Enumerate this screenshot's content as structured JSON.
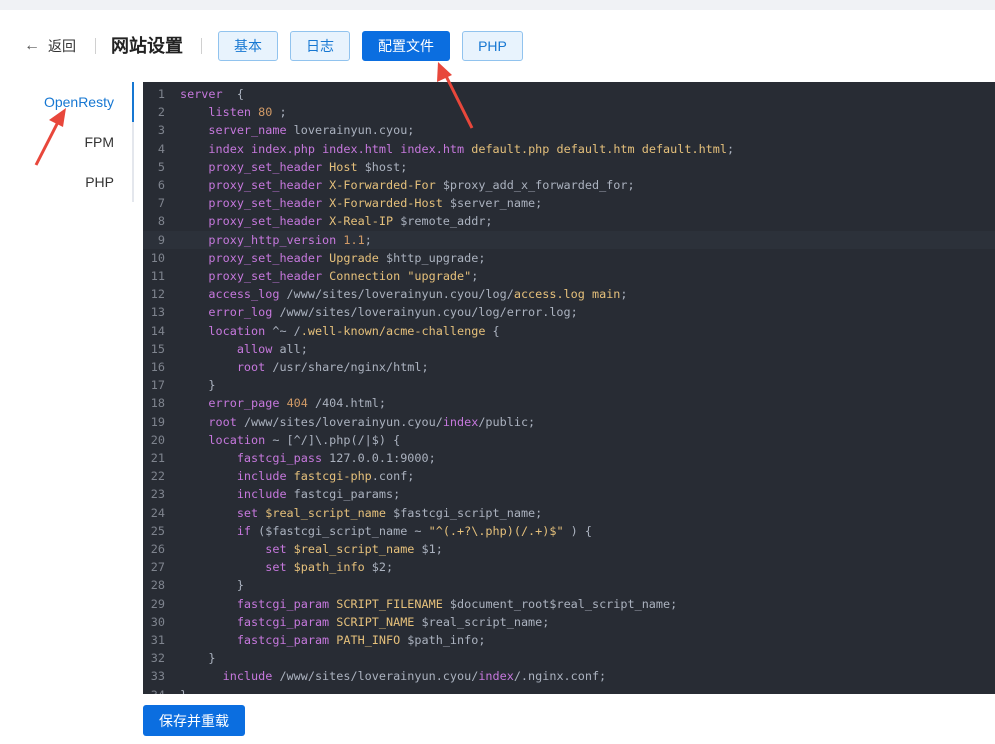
{
  "header": {
    "back_label": "返回",
    "title": "网站设置",
    "tabs": [
      {
        "label": "基本",
        "active": false
      },
      {
        "label": "日志",
        "active": false
      },
      {
        "label": "配置文件",
        "active": true
      },
      {
        "label": "PHP",
        "active": false
      }
    ]
  },
  "sidebar": {
    "items": [
      {
        "label": "OpenResty",
        "active": true
      },
      {
        "label": "FPM",
        "active": false
      },
      {
        "label": "PHP",
        "active": false
      }
    ]
  },
  "editor": {
    "theme": "dark",
    "current_line": 9,
    "lines": [
      {
        "n": "1",
        "segs": [
          [
            "kw",
            "server"
          ],
          [
            "",
            "  {"
          ]
        ]
      },
      {
        "n": "2",
        "segs": [
          [
            "",
            "    "
          ],
          [
            "kw",
            "listen"
          ],
          [
            "",
            "",
            " "
          ],
          [
            "nm",
            "80"
          ],
          [
            "",
            "",
            " ;"
          ]
        ]
      },
      {
        "n": "3",
        "segs": [
          [
            "",
            "    "
          ],
          [
            "kw",
            "server_name"
          ],
          [
            "",
            "",
            " loverainyun.cyou;"
          ]
        ]
      },
      {
        "n": "4",
        "segs": [
          [
            "",
            "    "
          ],
          [
            "kw",
            "index"
          ],
          [
            "",
            "",
            " "
          ],
          [
            "kw",
            "index.php"
          ],
          [
            "",
            "",
            " "
          ],
          [
            "kw",
            "index.html"
          ],
          [
            "",
            "",
            " "
          ],
          [
            "kw",
            "index.htm"
          ],
          [
            "",
            "",
            " "
          ],
          [
            "st",
            "default.php"
          ],
          [
            "",
            "",
            " "
          ],
          [
            "st",
            "default.htm"
          ],
          [
            "",
            "",
            " "
          ],
          [
            "st",
            "default.html"
          ],
          [
            "",
            ";"
          ]
        ]
      },
      {
        "n": "5",
        "segs": [
          [
            "",
            "    "
          ],
          [
            "kw",
            "proxy_set_header"
          ],
          [
            "",
            "",
            " "
          ],
          [
            "st",
            "Host"
          ],
          [
            "",
            "",
            " $host;"
          ]
        ]
      },
      {
        "n": "6",
        "segs": [
          [
            "",
            "    "
          ],
          [
            "kw",
            "proxy_set_header"
          ],
          [
            "",
            "",
            " "
          ],
          [
            "st",
            "X-Forwarded-For"
          ],
          [
            "",
            "",
            " $proxy_add_x_forwarded_for;"
          ]
        ]
      },
      {
        "n": "7",
        "segs": [
          [
            "",
            "    "
          ],
          [
            "kw",
            "proxy_set_header"
          ],
          [
            "",
            "",
            " "
          ],
          [
            "st",
            "X-Forwarded-Host"
          ],
          [
            "",
            "",
            " $server_name;"
          ]
        ]
      },
      {
        "n": "8",
        "segs": [
          [
            "",
            "    "
          ],
          [
            "kw",
            "proxy_set_header"
          ],
          [
            "",
            "",
            " "
          ],
          [
            "st",
            "X-Real-IP"
          ],
          [
            "",
            "",
            " $remote_addr;"
          ]
        ]
      },
      {
        "n": "9",
        "segs": [
          [
            "",
            "    "
          ],
          [
            "kw",
            "proxy_http_version"
          ],
          [
            "",
            "",
            " "
          ],
          [
            "nm",
            "1.1"
          ],
          [
            "",
            ";"
          ]
        ]
      },
      {
        "n": "10",
        "segs": [
          [
            "",
            "    "
          ],
          [
            "kw",
            "proxy_set_header"
          ],
          [
            "",
            "",
            " "
          ],
          [
            "st",
            "Upgrade"
          ],
          [
            "",
            "",
            " $http_upgrade;"
          ]
        ]
      },
      {
        "n": "11",
        "segs": [
          [
            "",
            "    "
          ],
          [
            "kw",
            "proxy_set_header"
          ],
          [
            "",
            "",
            " "
          ],
          [
            "st",
            "Connection"
          ],
          [
            "",
            "",
            " "
          ],
          [
            "st",
            "\"upgrade\""
          ],
          [
            "",
            ";"
          ]
        ]
      },
      {
        "n": "12",
        "segs": [
          [
            "",
            "    "
          ],
          [
            "kw",
            "access_log"
          ],
          [
            "",
            "",
            " /www/sites/loverainyun.cyou/log/"
          ],
          [
            "st",
            "access.log"
          ],
          [
            "",
            "",
            " "
          ],
          [
            "st",
            "main"
          ],
          [
            "",
            ";"
          ]
        ]
      },
      {
        "n": "13",
        "segs": [
          [
            "",
            "    "
          ],
          [
            "kw",
            "error_log"
          ],
          [
            "",
            "",
            " /www/sites/loverainyun.cyou/log/error.log;"
          ]
        ]
      },
      {
        "n": "14",
        "segs": [
          [
            "",
            "    "
          ],
          [
            "kw",
            "location"
          ],
          [
            "",
            "",
            " ^~ /"
          ],
          [
            "st",
            ".well-known/acme-challenge"
          ],
          [
            "",
            "",
            " {"
          ]
        ]
      },
      {
        "n": "15",
        "segs": [
          [
            "",
            "        "
          ],
          [
            "kw",
            "allow"
          ],
          [
            "",
            "",
            " all;"
          ]
        ]
      },
      {
        "n": "16",
        "segs": [
          [
            "",
            "        "
          ],
          [
            "kw",
            "root"
          ],
          [
            "",
            "",
            " /usr/share/nginx/html;"
          ]
        ]
      },
      {
        "n": "17",
        "segs": [
          [
            "",
            "    }"
          ]
        ]
      },
      {
        "n": "18",
        "segs": [
          [
            "",
            "    "
          ],
          [
            "kw",
            "error_page"
          ],
          [
            "",
            "",
            " "
          ],
          [
            "nm",
            "404"
          ],
          [
            "",
            "",
            " /404.html;"
          ]
        ]
      },
      {
        "n": "19",
        "segs": [
          [
            "",
            "    "
          ],
          [
            "kw",
            "root"
          ],
          [
            "",
            "",
            " /www/sites/loverainyun.cyou/"
          ],
          [
            "kw",
            "index"
          ],
          [
            "",
            "/public;"
          ]
        ]
      },
      {
        "n": "20",
        "segs": [
          [
            "",
            "    "
          ],
          [
            "kw",
            "location"
          ],
          [
            "",
            "",
            " ~ [^/]\\.php(/|$) {"
          ]
        ]
      },
      {
        "n": "21",
        "segs": [
          [
            "",
            "        "
          ],
          [
            "kw",
            "fastcgi_pass"
          ],
          [
            "",
            "",
            " 127.0.0.1:9000;"
          ]
        ]
      },
      {
        "n": "22",
        "segs": [
          [
            "",
            "        "
          ],
          [
            "kw",
            "include"
          ],
          [
            "",
            "",
            " "
          ],
          [
            "st",
            "fastcgi-php"
          ],
          [
            "",
            ".conf;"
          ]
        ]
      },
      {
        "n": "23",
        "segs": [
          [
            "",
            "        "
          ],
          [
            "kw",
            "include"
          ],
          [
            "",
            "",
            " fastcgi_params;"
          ]
        ]
      },
      {
        "n": "24",
        "segs": [
          [
            "",
            "        "
          ],
          [
            "kw",
            "set"
          ],
          [
            "",
            "",
            " "
          ],
          [
            "st",
            "$real_script_name"
          ],
          [
            "",
            "",
            " $fastcgi_script_name;"
          ]
        ]
      },
      {
        "n": "25",
        "segs": [
          [
            "",
            "        "
          ],
          [
            "kw",
            "if"
          ],
          [
            "",
            "",
            " ($fastcgi_script_name ~ "
          ],
          [
            "st",
            "\"^(.+?\\.php)(/.+)$\""
          ],
          [
            "",
            "",
            " ) {"
          ]
        ]
      },
      {
        "n": "26",
        "segs": [
          [
            "",
            "            "
          ],
          [
            "kw",
            "set"
          ],
          [
            "",
            "",
            " "
          ],
          [
            "st",
            "$real_script_name"
          ],
          [
            "",
            "",
            " $1;"
          ]
        ]
      },
      {
        "n": "27",
        "segs": [
          [
            "",
            "            "
          ],
          [
            "kw",
            "set"
          ],
          [
            "",
            "",
            " "
          ],
          [
            "st",
            "$path_info"
          ],
          [
            "",
            "",
            " $2;"
          ]
        ]
      },
      {
        "n": "28",
        "segs": [
          [
            "",
            "        }"
          ]
        ]
      },
      {
        "n": "29",
        "segs": [
          [
            "",
            "        "
          ],
          [
            "kw",
            "fastcgi_param"
          ],
          [
            "",
            "",
            " "
          ],
          [
            "st",
            "SCRIPT_FILENAME"
          ],
          [
            "",
            "",
            " $document_root$real_script_name;"
          ]
        ]
      },
      {
        "n": "30",
        "segs": [
          [
            "",
            "        "
          ],
          [
            "kw",
            "fastcgi_param"
          ],
          [
            "",
            "",
            " "
          ],
          [
            "st",
            "SCRIPT_NAME"
          ],
          [
            "",
            "",
            " $real_script_name;"
          ]
        ]
      },
      {
        "n": "31",
        "segs": [
          [
            "",
            "        "
          ],
          [
            "kw",
            "fastcgi_param"
          ],
          [
            "",
            "",
            " "
          ],
          [
            "st",
            "PATH_INFO"
          ],
          [
            "",
            "",
            " $path_info;"
          ]
        ]
      },
      {
        "n": "32",
        "segs": [
          [
            "",
            "    }"
          ]
        ]
      },
      {
        "n": "33",
        "segs": [
          [
            "",
            "      "
          ],
          [
            "kw",
            "include"
          ],
          [
            "",
            "",
            " /www/sites/loverainyun.cyou/"
          ],
          [
            "kw",
            "index"
          ],
          [
            "",
            "/.nginx.conf;"
          ]
        ]
      },
      {
        "n": "34",
        "segs": [
          [
            "",
            "}"
          ]
        ]
      }
    ]
  },
  "footer": {
    "save_label": "保存并重载"
  },
  "colors": {
    "accent": "#0b6ee0",
    "annotation_arrow": "#e8473b",
    "editor_bg": "#282c34"
  }
}
